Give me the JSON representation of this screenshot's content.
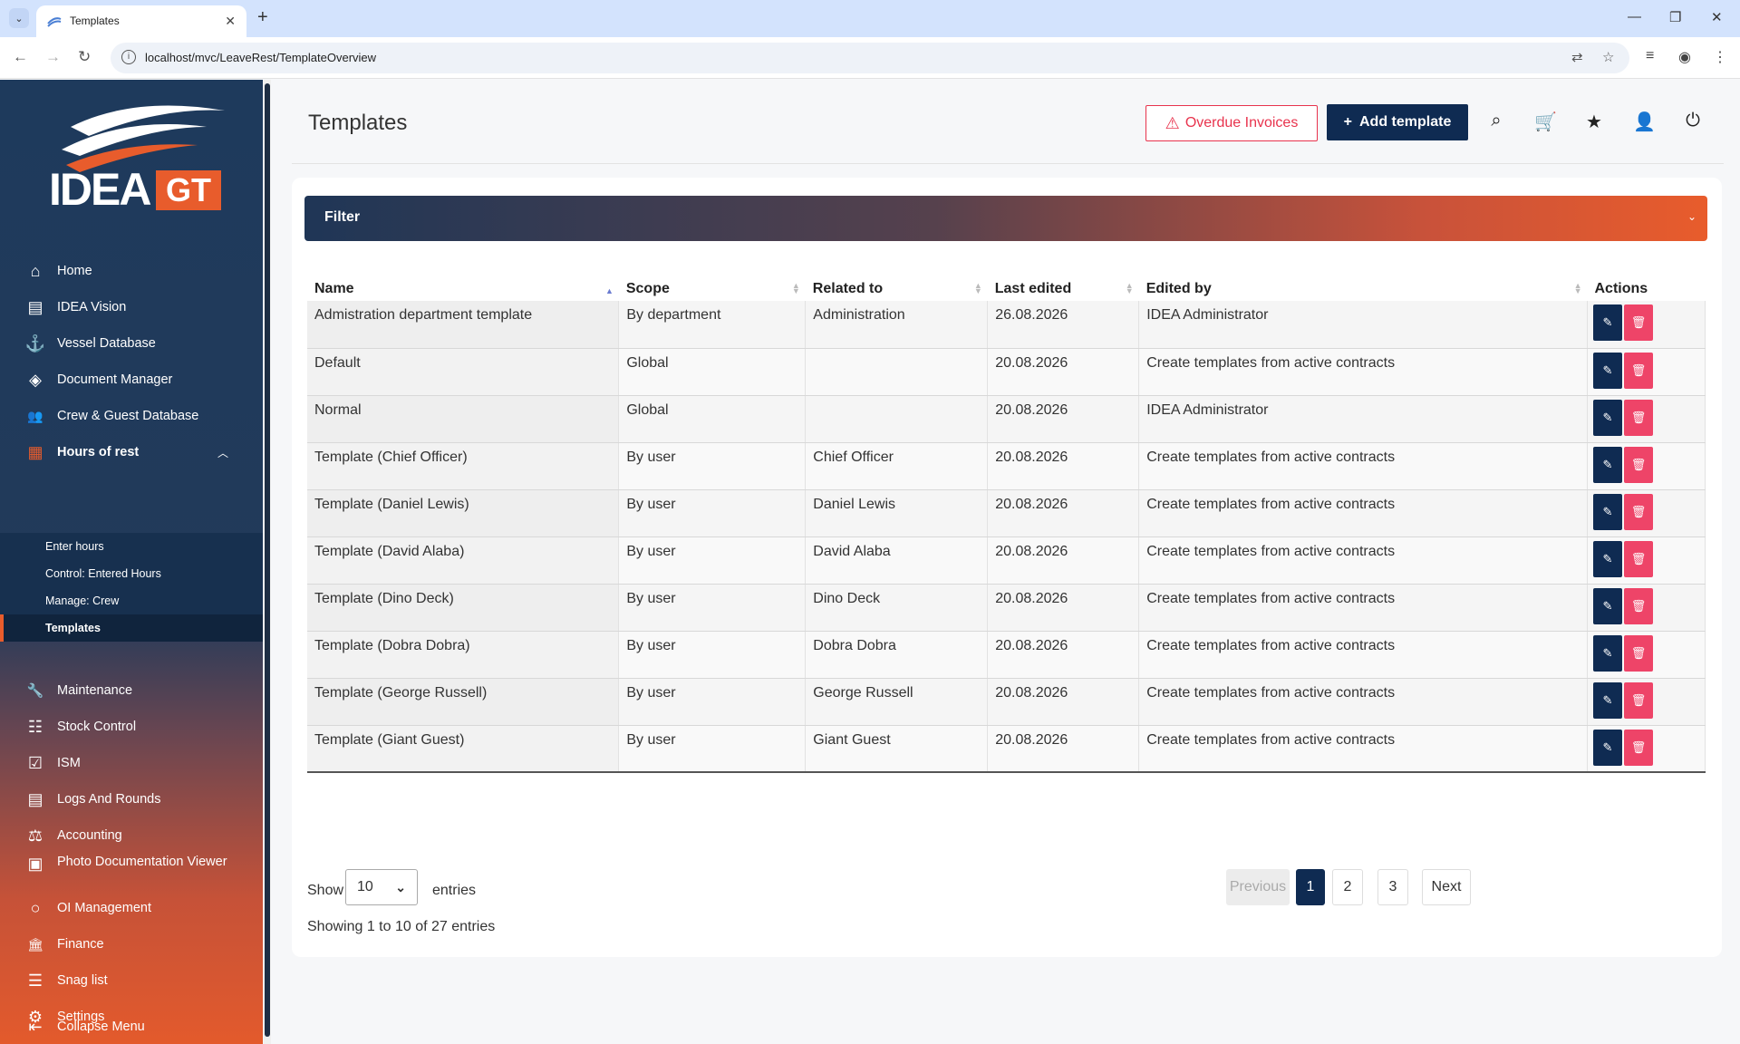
{
  "browser": {
    "tab_title": "Templates",
    "url": "localhost/mvc/LeaveRest/TemplateOverview"
  },
  "logo": {
    "word": "IDEA",
    "badge": "GT"
  },
  "sidebar": {
    "items": [
      {
        "label": "Home",
        "icon": "home-icon",
        "glyph": "⌂"
      },
      {
        "label": "IDEA Vision",
        "icon": "clipboard-icon",
        "glyph": "▤"
      },
      {
        "label": "Vessel Database",
        "icon": "anchor-icon",
        "glyph": "⚓"
      },
      {
        "label": "Document Manager",
        "icon": "layers-icon",
        "glyph": "◈"
      },
      {
        "label": "Crew & Guest Database",
        "icon": "users-icon",
        "glyph": "👥"
      },
      {
        "label": "Hours of rest",
        "icon": "calendar-icon",
        "glyph": "▦"
      }
    ],
    "submenu": [
      {
        "label": "Enter hours"
      },
      {
        "label": "Control: Entered Hours"
      },
      {
        "label": "Manage: Crew"
      },
      {
        "label": "Templates"
      }
    ],
    "items2": [
      {
        "label": "Maintenance",
        "icon": "wrench-icon",
        "glyph": "🔧"
      },
      {
        "label": "Stock Control",
        "icon": "stock-icon",
        "glyph": "☷"
      },
      {
        "label": "ISM",
        "icon": "checklist-icon",
        "glyph": "☑"
      },
      {
        "label": "Logs And Rounds",
        "icon": "logs-icon",
        "glyph": "▤"
      },
      {
        "label": "Accounting",
        "icon": "scale-icon",
        "glyph": "⚖"
      },
      {
        "label": "Photo Documentation Viewer",
        "icon": "photo-icon",
        "glyph": "▣"
      },
      {
        "label": "OI Management",
        "icon": "bulb-icon",
        "glyph": "○"
      },
      {
        "label": "Finance",
        "icon": "bank-icon",
        "glyph": "🏛"
      },
      {
        "label": "Snag list",
        "icon": "list-icon",
        "glyph": "☰"
      },
      {
        "label": "Settings",
        "icon": "gear-icon",
        "glyph": "⚙"
      }
    ],
    "collapse": "Collapse Menu"
  },
  "header": {
    "title": "Templates",
    "overdue_label": "Overdue Invoices",
    "add_label": "Add template"
  },
  "filter": {
    "label": "Filter"
  },
  "table": {
    "columns": [
      "Name",
      "Scope",
      "Related to",
      "Last edited",
      "Edited by",
      "Actions"
    ],
    "rows": [
      {
        "name": "Admistration department template",
        "scope": "By department",
        "related": "Administration",
        "edited": "26.08.2026",
        "by": "IDEA Administrator"
      },
      {
        "name": "Default",
        "scope": "Global",
        "related": "",
        "edited": "20.08.2026",
        "by": "Create templates from active contracts"
      },
      {
        "name": "Normal",
        "scope": "Global",
        "related": "",
        "edited": "20.08.2026",
        "by": "IDEA Administrator"
      },
      {
        "name": "Template (Chief Officer)",
        "scope": "By user",
        "related": "Chief Officer",
        "edited": "20.08.2026",
        "by": "Create templates from active contracts"
      },
      {
        "name": "Template (Daniel Lewis)",
        "scope": "By user",
        "related": "Daniel Lewis",
        "edited": "20.08.2026",
        "by": "Create templates from active contracts"
      },
      {
        "name": "Template (David Alaba)",
        "scope": "By user",
        "related": "David Alaba",
        "edited": "20.08.2026",
        "by": "Create templates from active contracts"
      },
      {
        "name": "Template (Dino Deck)",
        "scope": "By user",
        "related": "Dino Deck",
        "edited": "20.08.2026",
        "by": "Create templates from active contracts"
      },
      {
        "name": "Template (Dobra Dobra)",
        "scope": "By user",
        "related": "Dobra Dobra",
        "edited": "20.08.2026",
        "by": "Create templates from active contracts"
      },
      {
        "name": "Template (George Russell)",
        "scope": "By user",
        "related": "George Russell",
        "edited": "20.08.2026",
        "by": "Create templates from active contracts"
      },
      {
        "name": "Template (Giant Guest)",
        "scope": "By user",
        "related": "Giant Guest",
        "edited": "20.08.2026",
        "by": "Create templates from active contracts"
      }
    ]
  },
  "footer": {
    "show_label": "Show",
    "page_length": "10",
    "entries_label": "entries",
    "info": "Showing 1 to 10 of 27 entries",
    "pagination": {
      "previous": "Previous",
      "pages": [
        "1",
        "2",
        "3"
      ],
      "next": "Next"
    }
  },
  "colors": {
    "brand_navy": "#0f2b52",
    "brand_orange": "#e85c2c",
    "danger": "#e8334d"
  }
}
